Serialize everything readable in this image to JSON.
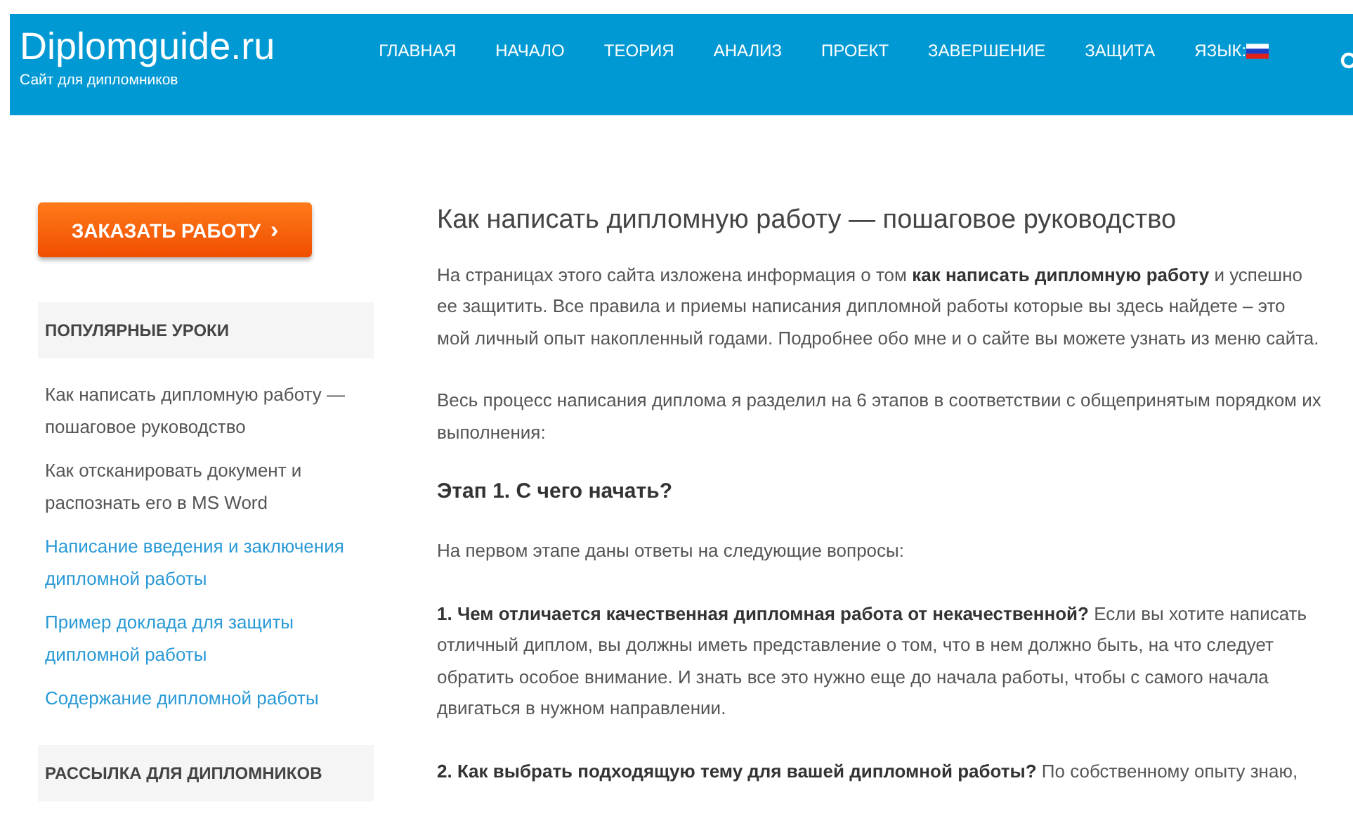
{
  "header": {
    "logo": "Diplomguide.ru",
    "tagline": "Сайт для дипломников",
    "nav": [
      {
        "label": "ГЛАВНАЯ"
      },
      {
        "label": "НАЧАЛО"
      },
      {
        "label": "ТЕОРИЯ"
      },
      {
        "label": "АНАЛИЗ"
      },
      {
        "label": "ПРОЕКТ"
      },
      {
        "label": "ЗАВЕРШЕНИЕ"
      },
      {
        "label": "ЗАЩИТА"
      }
    ],
    "language_label": "ЯЗЫК:"
  },
  "sidebar": {
    "order_button": "ЗАКАЗАТЬ РАБОТУ",
    "order_button_arrow": "›",
    "widgets": [
      {
        "title": "ПОПУЛЯРНЫЕ УРОКИ",
        "links": [
          {
            "text": "Как написать дипломную работу — пошаговое руководство",
            "visited": true
          },
          {
            "text": "Как отсканировать документ и распознать его в MS Word",
            "visited": true
          },
          {
            "text": "Написание введения и заключения дипломной работы",
            "visited": false
          },
          {
            "text": "Пример доклада для защиты дипломной работы",
            "visited": false
          },
          {
            "text": "Содержание дипломной работы",
            "visited": false
          }
        ]
      },
      {
        "title": "РАССЫЛКА ДЛЯ ДИПЛОМНИКОВ"
      }
    ]
  },
  "article": {
    "title": "Как написать дипломную работу — пошаговое руководство",
    "blocks": [
      {
        "kind": "paragraph",
        "text": "На страницах этого сайта изложена информация о том **как написать дипломную работу** и успешно ее защитить. Все правила и приемы написания дипломной работы которые вы здесь найдете – это мой личный опыт накопленный годами. Подробнее обо мне и о сайте вы можете узнать из меню сайта."
      },
      {
        "kind": "paragraph",
        "text": "Весь процесс написания диплома я разделил на 6 этапов в соответствии с общепринятым порядком их выполнения:"
      },
      {
        "kind": "heading",
        "text": "Этап 1. С чего начать?"
      },
      {
        "kind": "paragraph",
        "text": "На первом этапе даны ответы на следующие вопросы:"
      },
      {
        "kind": "paragraph",
        "text": "**1. Чем отличается качественная дипломная работа от некачественной?** Если вы хотите написать отличный диплом, вы должны иметь представление о том, что в нем должно быть, на что следует обратить особое внимание. И знать все это нужно еще до начала работы, чтобы с самого начала двигаться в нужном направлении."
      },
      {
        "kind": "paragraph",
        "text": "**2. Как выбрать подходящую тему для вашей дипломной работы?** По собственному опыту знаю,"
      }
    ]
  }
}
